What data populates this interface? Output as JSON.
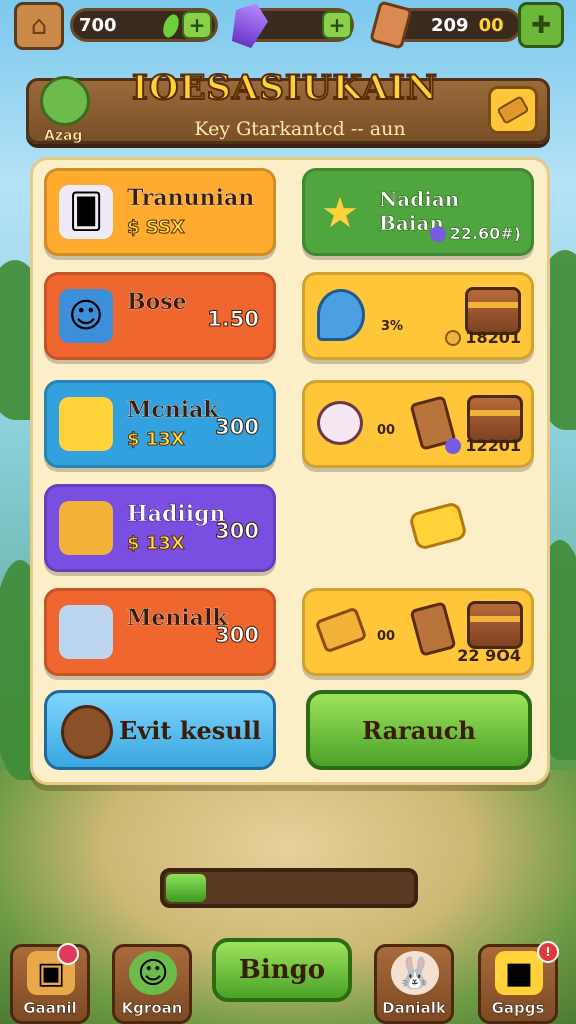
{
  "topbar": {
    "home_icon": "house-icon",
    "coins_value": "700",
    "gems_icon": "purple-crystal-icon",
    "tickets_value": "209",
    "tickets_suffix": "00",
    "plus_label": "+"
  },
  "header": {
    "title": "IOESASIUKAIN",
    "subtitle": "Key Gtarkantcd -- aun",
    "avatar_label": "Azag"
  },
  "left_cards": [
    {
      "name": "Tranunian",
      "price": "$ SSX",
      "value": "",
      "icon": "card-icon",
      "color": "#ffab2f"
    },
    {
      "name": "Bose",
      "price": "",
      "value": "1.50",
      "icon": "blue-robot-icon",
      "color": "#f0662f"
    },
    {
      "name": "Mcniak",
      "price": "$ 13X",
      "value": "300",
      "icon": "butter-icon",
      "color": "#33a1dd"
    },
    {
      "name": "Hadiign",
      "price": "$ 13X",
      "value": "300",
      "icon": "scroll-icon",
      "color": "#7a4ee0"
    },
    {
      "name": "Menialk",
      "price": "",
      "value": "300",
      "icon": "blue-cube-icon",
      "color": "#f0662f"
    }
  ],
  "right_cards": [
    {
      "name": "Nadian Baian",
      "value": "22.60#)",
      "color": "#4fa63f"
    },
    {
      "sub": "3%",
      "value": "18201",
      "color": "#ffc63a"
    },
    {
      "sub": "00",
      "value": "12201",
      "color": "#ffc63a"
    },
    {
      "sub": "00",
      "value": "22 9O4",
      "color": "#ffc63a"
    }
  ],
  "actions": {
    "left_label": "Evit kesull",
    "right_label": "Rarauch"
  },
  "progress": {
    "fraction": 0.16
  },
  "nav": {
    "items": [
      {
        "label": "Gaanil",
        "icon": "crate-icon",
        "badge": ""
      },
      {
        "label": "Kgroan",
        "icon": "green-avatar-icon",
        "badge": ""
      },
      {
        "label": "Danialk",
        "icon": "bunny-icon",
        "badge": ""
      },
      {
        "label": "Gapgs",
        "icon": "gift-icon",
        "badge": "!"
      }
    ],
    "center_label": "Bingo"
  }
}
